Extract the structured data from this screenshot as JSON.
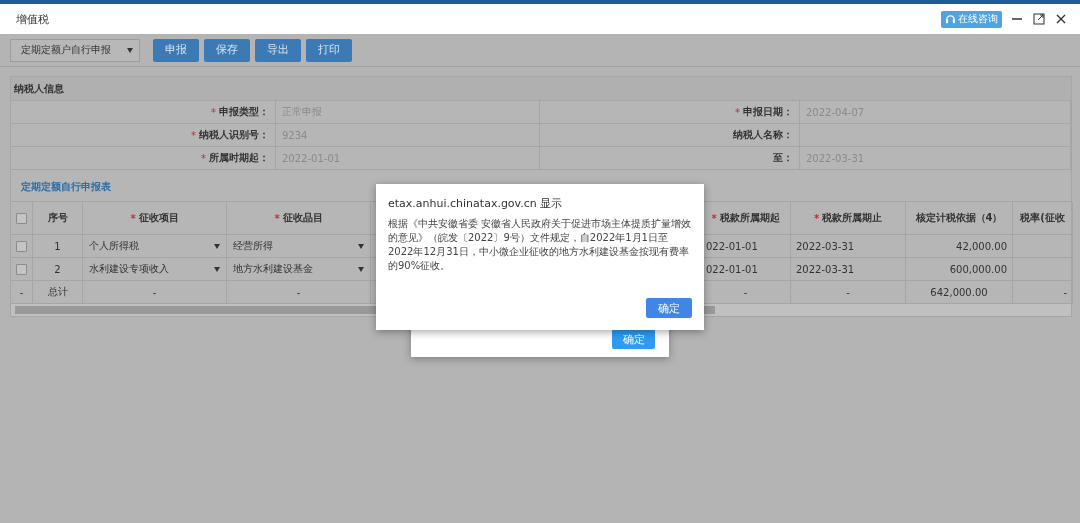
{
  "window": {
    "title": "增值税",
    "consult_button": "在线咨询"
  },
  "toolbar": {
    "mode_select": "定期定额户自行申报",
    "buttons": [
      "申报",
      "保存",
      "导出",
      "打印"
    ]
  },
  "taxpayer_info": {
    "title": "纳税人信息",
    "fields": [
      {
        "mark": "*",
        "label": "申报类型：",
        "value": "正常申报"
      },
      {
        "mark": "*",
        "label": "申报日期：",
        "value": "2022-04-07"
      },
      {
        "mark": "*",
        "label": "纳税人识别号：",
        "value": "9234"
      },
      {
        "label": "纳税人名称："
      },
      {
        "mark": "*",
        "label": "所属时期起：",
        "value": "2022-01-01"
      },
      {
        "label": "至：",
        "value": "2022-03-31"
      }
    ]
  },
  "table": {
    "title": "定期定额自行申报表",
    "all_checked": false,
    "columns": [
      {
        "label": "序号"
      },
      {
        "mark": "*",
        "label": "征收项目"
      },
      {
        "mark": "*",
        "label": "征收品目"
      },
      {
        "mark": "*",
        "label": "税款所属期起"
      },
      {
        "mark": "*",
        "label": "税款所属期止"
      },
      {
        "label": "核定计税依据（4）"
      },
      {
        "label": "税率(征收"
      }
    ],
    "rows": [
      {
        "checked": false,
        "index": "1",
        "item": "个人所得税",
        "subitem": "经营所得",
        "period_start": "022-01-01",
        "period_end": "2022-03-31",
        "basis": "42,000.00"
      },
      {
        "checked": false,
        "index": "2",
        "item": "水利建设专项收入",
        "subitem": "地方水利建设基金",
        "period_start": "022-01-01",
        "period_end": "2022-03-31",
        "basis": "600,000.00"
      }
    ],
    "total": {
      "mark": "-",
      "label": "总计",
      "item": "-",
      "subitem": "-",
      "period_start": "-",
      "period_end": "-",
      "basis": "642,000.00",
      "rate": "-"
    }
  },
  "alert": {
    "title": "etax.anhui.chinatax.gov.cn 显示",
    "message": "根据《中共安徽省委 安徽省人民政府关于促进市场主体提质扩量增效的意见》（皖发〔2022〕9号）文件规定，自2022年1月1日至2022年12月31日，中小微企业征收的地方水利建设基金按现有费率的90%征收。",
    "button": "确定"
  },
  "back_dialog": {
    "button": "确定"
  }
}
